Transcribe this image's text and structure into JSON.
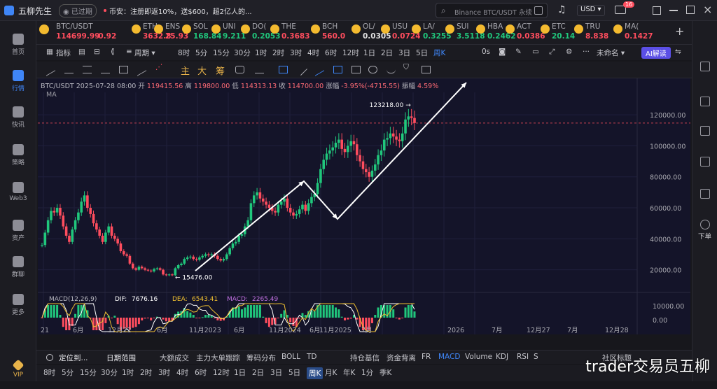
{
  "app": {
    "title": "五柳先生",
    "expired_badge": "已过期",
    "notice_prefix": "币安：",
    "notice_text": "注册即返10%，送$600，超2亿人的...",
    "search_placeholder": "Binance BTC/USDT 永续",
    "currency": "USD",
    "mail_badge": "16"
  },
  "sidebar": {
    "items": [
      {
        "label": "首页"
      },
      {
        "label": "行情",
        "active": true
      },
      {
        "label": "快讯"
      },
      {
        "label": "策略"
      },
      {
        "label": "Web3"
      },
      {
        "label": "资产"
      },
      {
        "label": "群聊"
      },
      {
        "label": "更多"
      },
      {
        "label": "VIP"
      }
    ]
  },
  "rightbar": {
    "download_label": "下单"
  },
  "ticker": [
    {
      "name": "BTC/USDT",
      "price": "114699.99",
      "change": "-0.92",
      "color": "#ff4d5e"
    },
    {
      "name": "ETH",
      "price": "3632.8",
      "color": "#ff4d5e"
    },
    {
      "name": "ENS",
      "price": "25.93",
      "color": "#ff4d5e"
    },
    {
      "name": "SOL",
      "price": "168.84",
      "color": "#20c77c"
    },
    {
      "name": "UNI",
      "price": "9.211",
      "color": "#20c77c"
    },
    {
      "name": "DO(",
      "price": "0.2053",
      "color": "#20c77c"
    },
    {
      "name": "THE",
      "price": "0.3683",
      "color": "#ff4d5e"
    },
    {
      "name": "BCH",
      "price": "560.0",
      "color": "#ff4d5e"
    },
    {
      "name": "OL/",
      "price": "0.0305",
      "color": "#e0e0e0"
    },
    {
      "name": "USU",
      "price": "0.0724",
      "color": "#ff4d5e"
    },
    {
      "name": "LA/",
      "price": "0.3255",
      "color": "#20c77c"
    },
    {
      "name": "SUI",
      "price": "3.5118",
      "color": "#20c77c"
    },
    {
      "name": "HBA",
      "price": "0.2462",
      "color": "#20c77c"
    },
    {
      "name": "ACT",
      "price": "0.0386",
      "color": "#ff4d5e"
    },
    {
      "name": "ETC",
      "price": "20.14",
      "color": "#20c77c"
    },
    {
      "name": "TRU",
      "price": "8.838",
      "color": "#ff4d5e"
    },
    {
      "name": "MA(",
      "price": "0.1427",
      "color": "#ff4d5e"
    }
  ],
  "toolbar": {
    "indicator": "指标",
    "period": "周期",
    "intervals": [
      "8时",
      "5分",
      "15分",
      "30分",
      "1时",
      "2时",
      "3时",
      "4时",
      "6时",
      "12时",
      "1日",
      "2日",
      "3日",
      "5日",
      "周K"
    ],
    "active_interval": "周K",
    "countdown": "0s",
    "template": "未命名",
    "ai_button": "AI解读",
    "draw_main": "主",
    "draw_big": "大",
    "draw_chip": "筹"
  },
  "chart_header": {
    "pair": "BTC/USDT",
    "date": "2025-07-28 08:00",
    "open_label": "开",
    "open": "119415.56",
    "high_label": "高",
    "high": "119800.00",
    "low_label": "低",
    "low": "114313.13",
    "close_label": "收",
    "close": "114700.00",
    "change_label": "涨幅",
    "change": "-3.95%(-4715.55)",
    "amp_label": "振幅",
    "amp": "4.59%",
    "ma": "MA"
  },
  "chart_data": {
    "type": "candlestick",
    "y_ticks": [
      "120000.00",
      "100000.00",
      "80000.00",
      "60000.00",
      "40000.00",
      "20000.00"
    ],
    "ylim": [
      9000,
      130000
    ],
    "x_ticks": [
      "21",
      "6月",
      "12月22",
      "6月",
      "11月2023",
      "6月",
      "11月2024",
      "6月",
      "11月2025",
      "7月",
      "2026",
      "7月",
      "12月27",
      "7月",
      "12月28"
    ],
    "high_annotation": "123218.00 →",
    "low_annotation": "← 15476.00",
    "current_price_line": 114700,
    "weekly_closes": [
      36000,
      44000,
      52000,
      58000,
      57000,
      60000,
      55000,
      48000,
      42000,
      38000,
      46000,
      52000,
      57000,
      64000,
      68000,
      60000,
      56000,
      50000,
      46000,
      42000,
      38000,
      44000,
      48000,
      42000,
      40000,
      37000,
      32000,
      30000,
      29000,
      24000,
      21000,
      20000,
      22000,
      21000,
      20000,
      19500,
      19000,
      20500,
      21000,
      20000,
      17000,
      16500,
      17000,
      16500,
      21000,
      23000,
      24000,
      27000,
      28000,
      28500,
      27000,
      26500,
      28000,
      29000,
      30000,
      29500,
      30000,
      29000,
      27000,
      26000,
      27000,
      30000,
      34000,
      37000,
      38000,
      42000,
      43000,
      48000,
      52000,
      63000,
      68000,
      70000,
      66000,
      64000,
      62000,
      60000,
      58000,
      57000,
      62000,
      64000,
      66000,
      60000,
      57000,
      55000,
      56000,
      59000,
      62000,
      58000,
      63000,
      67000,
      69000,
      76000,
      85000,
      91000,
      95000,
      97000,
      99000,
      102000,
      104000,
      98000,
      96000,
      100000,
      103000,
      101000,
      94000,
      90000,
      85000,
      83000,
      80000,
      84000,
      88000,
      94000,
      97000,
      104000,
      105000,
      108000,
      106000,
      104000,
      103000,
      108000,
      117000,
      119000,
      118000,
      114700
    ],
    "macd": {
      "label": "MACD(12,26,9)",
      "dif_label": "DIF:",
      "dif": "7676.16",
      "dea_label": "DEA:",
      "dea": "6543.41",
      "macd_label": "MACD:",
      "macd_value": "2265.49",
      "y_ticks": [
        "10000.00",
        "0.00"
      ]
    }
  },
  "bottom": {
    "row1": [
      "定位到...",
      "日期范围",
      "大额成交",
      "主力大单跟踪",
      "筹码分布",
      "BOLL",
      "TD",
      "持仓基信",
      "资金背离",
      "FR",
      "MACD",
      "Volume",
      "KDJ",
      "RSI",
      "S"
    ],
    "row2": [
      "8时",
      "5分",
      "15分",
      "30分",
      "1时",
      "2时",
      "3时",
      "4时",
      "6时",
      "12时",
      "1日",
      "2日",
      "3日",
      "5日",
      "周K",
      "月K",
      "年K",
      "1分",
      "季K"
    ],
    "active_row2": "周K",
    "right_partial": "社区标题"
  },
  "watermark": "trader交易员五柳"
}
